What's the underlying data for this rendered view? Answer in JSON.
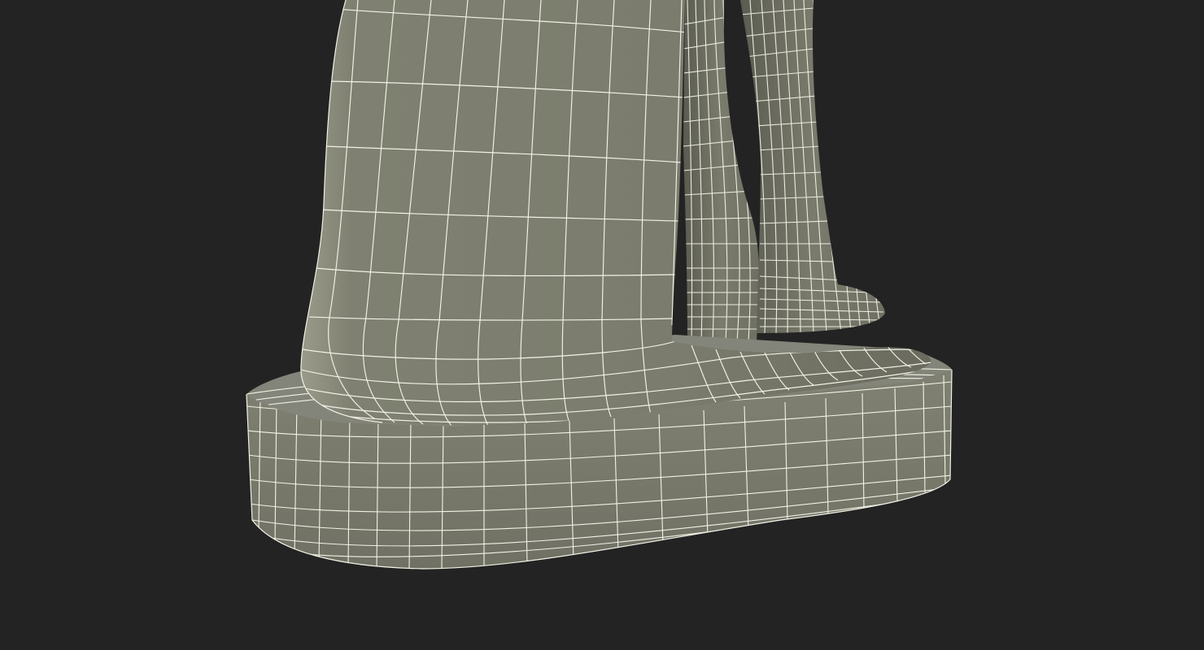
{
  "scene": {
    "background_color": "#232323",
    "model": {
      "surface_color": "#7c7d6e",
      "shadow_color": "#5e5f53",
      "highlight_color": "#8f907f",
      "wire_color": "#f2f2e6",
      "parts": [
        "front-leg",
        "rear-leg",
        "rear-paw",
        "base-plinth",
        "base-top-surface"
      ]
    }
  }
}
